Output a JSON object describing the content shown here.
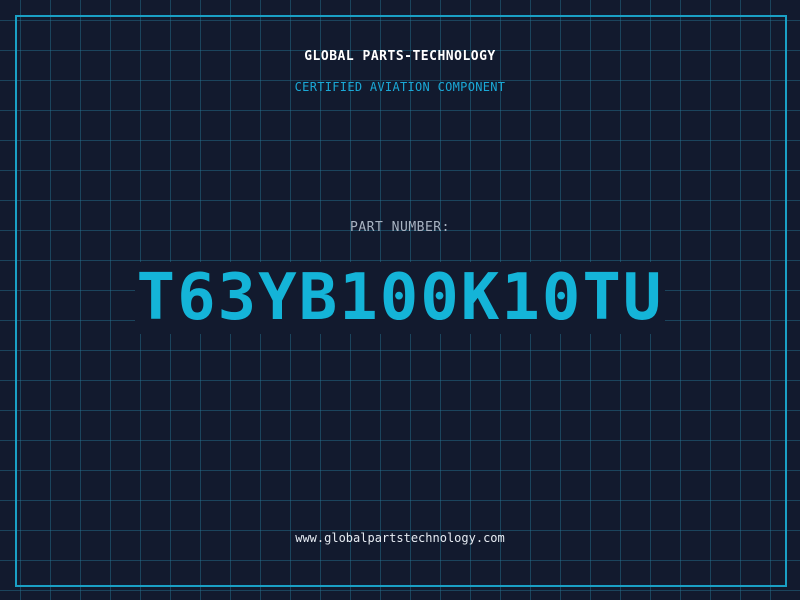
{
  "label": {
    "company_name": "GLOBAL PARTS-TECHNOLOGY",
    "subtitle": "CERTIFIED AVIATION COMPONENT",
    "part_label": "PART NUMBER:",
    "part_number": "T63YB100K10TU",
    "website": "www.globalpartstechnology.com"
  },
  "colors": {
    "background": "#121a2e",
    "accent": "#14b4d8",
    "grid": "#26789a",
    "text": "#ffffff"
  }
}
